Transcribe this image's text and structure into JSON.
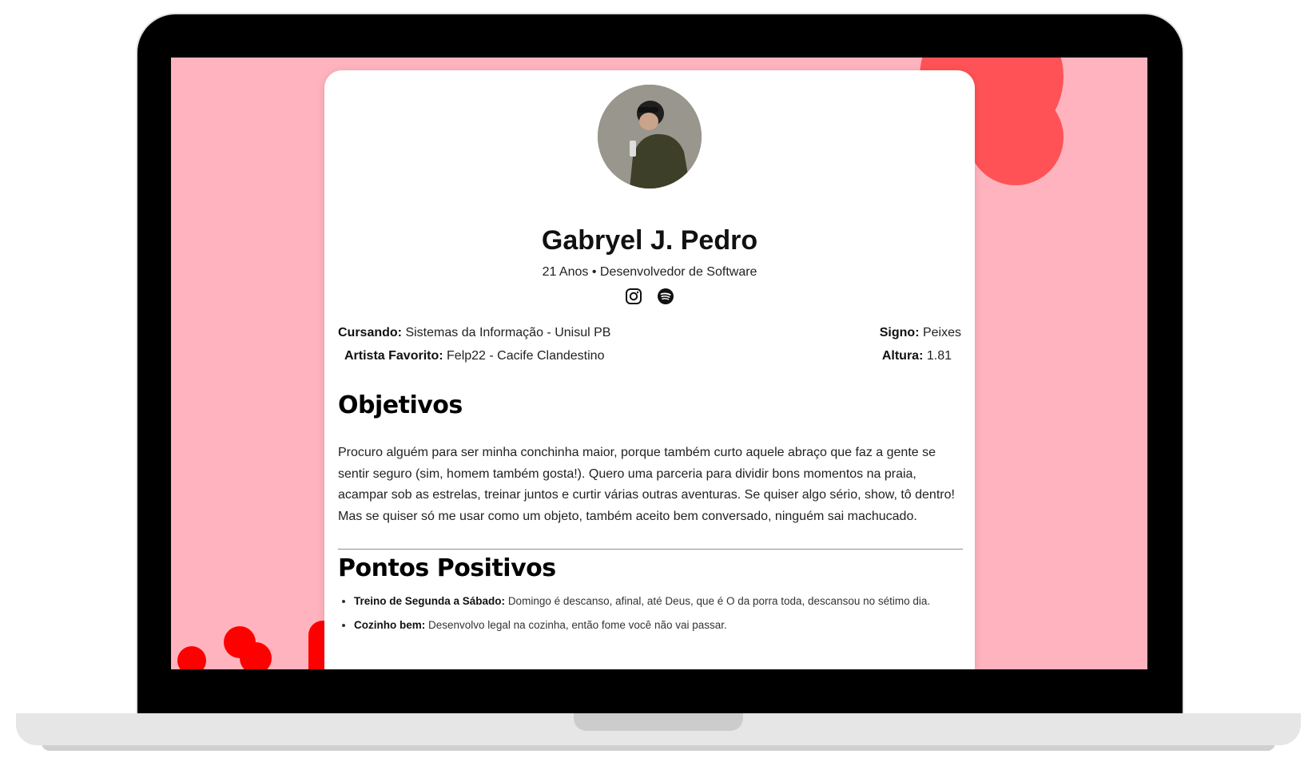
{
  "profile": {
    "name": "Gabryel J. Pedro",
    "subtitle": "21 Anos • Desenvolvedor de Software"
  },
  "socials": [
    {
      "icon": "instagram-icon"
    },
    {
      "icon": "spotify-icon"
    }
  ],
  "info": {
    "cursando_label": "Cursando:",
    "cursando_value": "Sistemas da Informação - Unisul PB",
    "signo_label": "Signo:",
    "signo_value": "Peixes",
    "artista_label": "Artista Favorito:",
    "artista_value": "Felp22 - Cacife Clandestino",
    "altura_label": "Altura:",
    "altura_value": "1.81"
  },
  "objetivos": {
    "title": "Objetivos",
    "text": "Procuro alguém para ser minha conchinha maior, porque também curto aquele abraço que faz a gente se sentir seguro (sim, homem também gosta!). Quero uma parceria para dividir bons momentos na praia, acampar sob as estrelas, treinar juntos e curtir várias outras aventuras. Se quiser algo sério, show, tô dentro! Mas se quiser só me usar como um objeto, também aceito bem conversado, ninguém sai machucado."
  },
  "pontos": {
    "title": "Pontos Positivos",
    "items": [
      {
        "label": "Treino de Segunda a Sábado:",
        "text": "Domingo é descanso, afinal, até Deus, que é O da porra toda, descansou no sétimo dia."
      },
      {
        "label": "Cozinho bem:",
        "text": "Desenvolvo legal na cozinha, então fome você não vai passar."
      }
    ]
  },
  "colors": {
    "background": "#ffb3be",
    "heart_coral": "#ff5257",
    "heart_red": "#ff0000"
  }
}
